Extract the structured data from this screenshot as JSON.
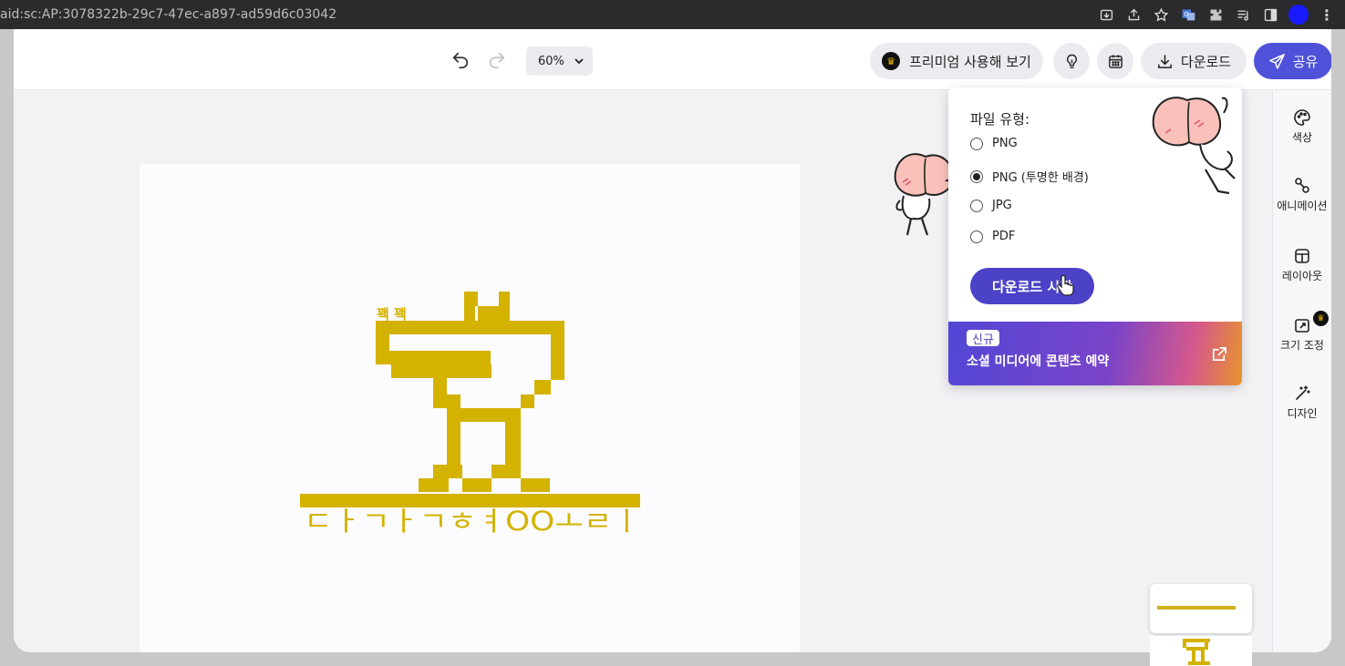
{
  "browser": {
    "url": "aid:sc:AP:3078322b-29c7-47ec-a897-ad59d6c03042",
    "profile_color": "#1a1aff"
  },
  "toolbar": {
    "zoom_value": "60%",
    "premium_label": "프리미엄 사용해 보기",
    "download_label": "다운로드",
    "share_label": "공유",
    "share_color": "#4f52d8"
  },
  "canvas": {
    "small_text": "꽥 꽥",
    "bottom_text": "ㄷㅏㄱㅏㄱㅎㅕOOㅗㄹㅣ",
    "accent_color": "#d4b200"
  },
  "download_menu": {
    "heading": "파일 유형:",
    "options": [
      {
        "label": "PNG",
        "checked": false
      },
      {
        "label": "PNG (투명한 배경)",
        "checked": true
      },
      {
        "label": "JPG",
        "checked": false
      },
      {
        "label": "PDF",
        "checked": false
      }
    ],
    "start_button": "다운로드 시작",
    "promo_badge": "신규",
    "promo_text": "소셜 미디어에 콘텐츠 예약"
  },
  "sidebar": {
    "items": [
      {
        "label": "색상",
        "icon": "palette-icon"
      },
      {
        "label": "애니메이션",
        "icon": "animation-icon"
      },
      {
        "label": "레이아웃",
        "icon": "layout-icon"
      },
      {
        "label": "크기 조정",
        "icon": "resize-icon",
        "premium": true
      },
      {
        "label": "디자인",
        "icon": "magic-wand-icon"
      }
    ]
  }
}
